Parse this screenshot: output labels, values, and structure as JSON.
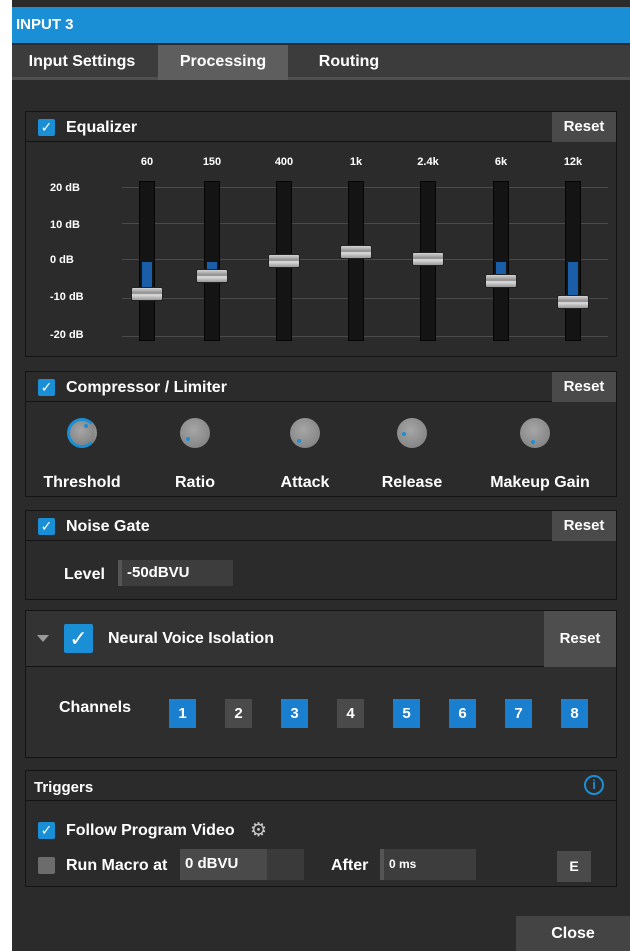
{
  "window": {
    "title": "INPUT 3"
  },
  "tabs": [
    "Input Settings",
    "Processing",
    "Routing"
  ],
  "equalizer": {
    "enabled": true,
    "title": "Equalizer",
    "reset_label": "Reset",
    "bands": [
      "60",
      "150",
      "400",
      "1k",
      "2.4k",
      "6k",
      "12k"
    ],
    "db_labels": [
      "20 dB",
      "10 dB",
      "0 dB",
      "-10 dB",
      "-20 dB"
    ],
    "gains_db": [
      -9,
      -4,
      0,
      2.5,
      0.5,
      -5.5,
      -11
    ]
  },
  "compressor": {
    "enabled": true,
    "title": "Compressor / Limiter",
    "reset_label": "Reset",
    "knobs": [
      "Threshold",
      "Ratio",
      "Attack",
      "Release",
      "Makeup Gain"
    ]
  },
  "noise_gate": {
    "enabled": true,
    "title": "Noise Gate",
    "reset_label": "Reset",
    "level_label": "Level",
    "level_value": "-50dBVU"
  },
  "voice_isolation": {
    "enabled": true,
    "title": "Neural Voice Isolation",
    "reset_label": "Reset",
    "channels_label": "Channels",
    "channels": [
      {
        "label": "1",
        "on": true
      },
      {
        "label": "2",
        "on": false
      },
      {
        "label": "3",
        "on": true
      },
      {
        "label": "4",
        "on": false
      },
      {
        "label": "5",
        "on": true
      },
      {
        "label": "6",
        "on": true
      },
      {
        "label": "7",
        "on": true
      },
      {
        "label": "8",
        "on": true
      }
    ]
  },
  "triggers": {
    "title": "Triggers",
    "follow_program": {
      "checked": true,
      "label": "Follow Program Video"
    },
    "run_macro": {
      "checked": false,
      "label": "Run Macro at",
      "value": "0 dBVU"
    },
    "after_label": "After",
    "after_value": "0 ms",
    "edit_label": "E"
  },
  "footer": {
    "close_label": "Close"
  },
  "colors": {
    "accent": "#1a8fd6",
    "panel": "#2b2b2b",
    "eq_fill": "#1a5ea8"
  }
}
